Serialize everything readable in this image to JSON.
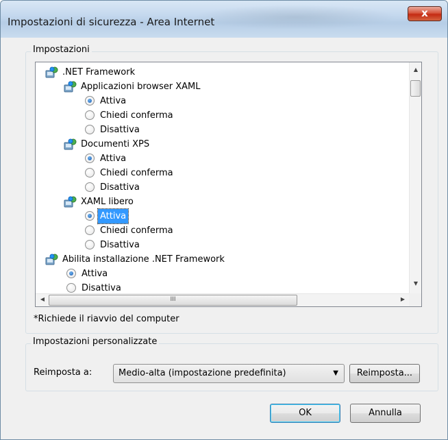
{
  "window": {
    "title": "Impostazioni di sicurezza - Area Internet",
    "close_label": "x"
  },
  "settings_group": {
    "legend": "Impostazioni",
    "tree": [
      {
        "type": "node",
        "label": ".NET Framework",
        "level": 0
      },
      {
        "type": "node",
        "label": "Applicazioni browser XAML",
        "level": 1
      },
      {
        "type": "option",
        "label": "Attiva",
        "checked": true,
        "level": 2
      },
      {
        "type": "option",
        "label": "Chiedi conferma",
        "checked": false,
        "level": 2
      },
      {
        "type": "option",
        "label": "Disattiva",
        "checked": false,
        "level": 2
      },
      {
        "type": "node",
        "label": "Documenti XPS",
        "level": 1
      },
      {
        "type": "option",
        "label": "Attiva",
        "checked": true,
        "level": 2
      },
      {
        "type": "option",
        "label": "Chiedi conferma",
        "checked": false,
        "level": 2
      },
      {
        "type": "option",
        "label": "Disattiva",
        "checked": false,
        "level": 2
      },
      {
        "type": "node",
        "label": "XAML libero",
        "level": 1
      },
      {
        "type": "option",
        "label": "Attiva",
        "checked": true,
        "selected": true,
        "level": 2
      },
      {
        "type": "option",
        "label": "Chiedi conferma",
        "checked": false,
        "level": 2
      },
      {
        "type": "option",
        "label": "Disattiva",
        "checked": false,
        "level": 2
      },
      {
        "type": "node",
        "label": "Abilita installazione .NET Framework",
        "level": 0
      },
      {
        "type": "option",
        "label": "Attiva",
        "checked": true,
        "level": 1
      },
      {
        "type": "option",
        "label": "Disattiva",
        "checked": false,
        "level": 1
      }
    ],
    "hscroll_grip": "III",
    "footnote": "*Richiede il riavvio del computer"
  },
  "custom_group": {
    "legend": "Impostazioni personalizzate",
    "reset_label": "Reimposta a:",
    "reset_value": "Medio-alta (impostazione predefinita)",
    "reset_button": "Reimposta..."
  },
  "buttons": {
    "ok": "OK",
    "cancel": "Annulla"
  },
  "icons": {
    "node": "dotnet-setting-icon",
    "close": "close-icon"
  }
}
